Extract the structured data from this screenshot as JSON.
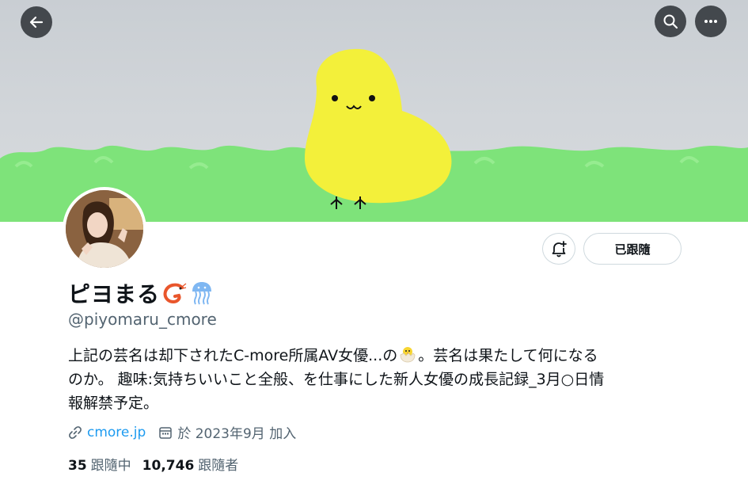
{
  "profile": {
    "name": "ピヨまる",
    "handle": "@piyomaru_cmore",
    "bio_line1": "上記の芸名は却下されたC-more所属AV女優...の",
    "bio_line1b": "。芸名は果たして何になる",
    "bio_line2": "のか。 趣味:気持ちいいこと全般、を仕事にした新人女優の成長記録_3月○日情",
    "bio_line3": "報解禁予定。",
    "website": "cmore.jp",
    "joined": "於 2023年9月 加入"
  },
  "actions": {
    "follow_label": "已跟隨"
  },
  "stats": {
    "following_count": "35",
    "following_label": "跟隨中",
    "followers_count": "10,746",
    "followers_label": "跟隨者"
  },
  "icons": {
    "back": "arrow-left-icon",
    "search": "search-icon",
    "more": "more-dots-icon",
    "notify": "bell-plus-icon",
    "link": "link-icon",
    "calendar": "calendar-icon",
    "shrimp": "shrimp-emoji-icon",
    "jellyfish": "jellyfish-emoji-icon",
    "chick": "hatching-chick-emoji-icon"
  },
  "colors": {
    "accent": "#1d9bf0",
    "secondary_text": "#536471",
    "chick_yellow": "#f3f03a",
    "grass_green": "#7ee37a"
  }
}
